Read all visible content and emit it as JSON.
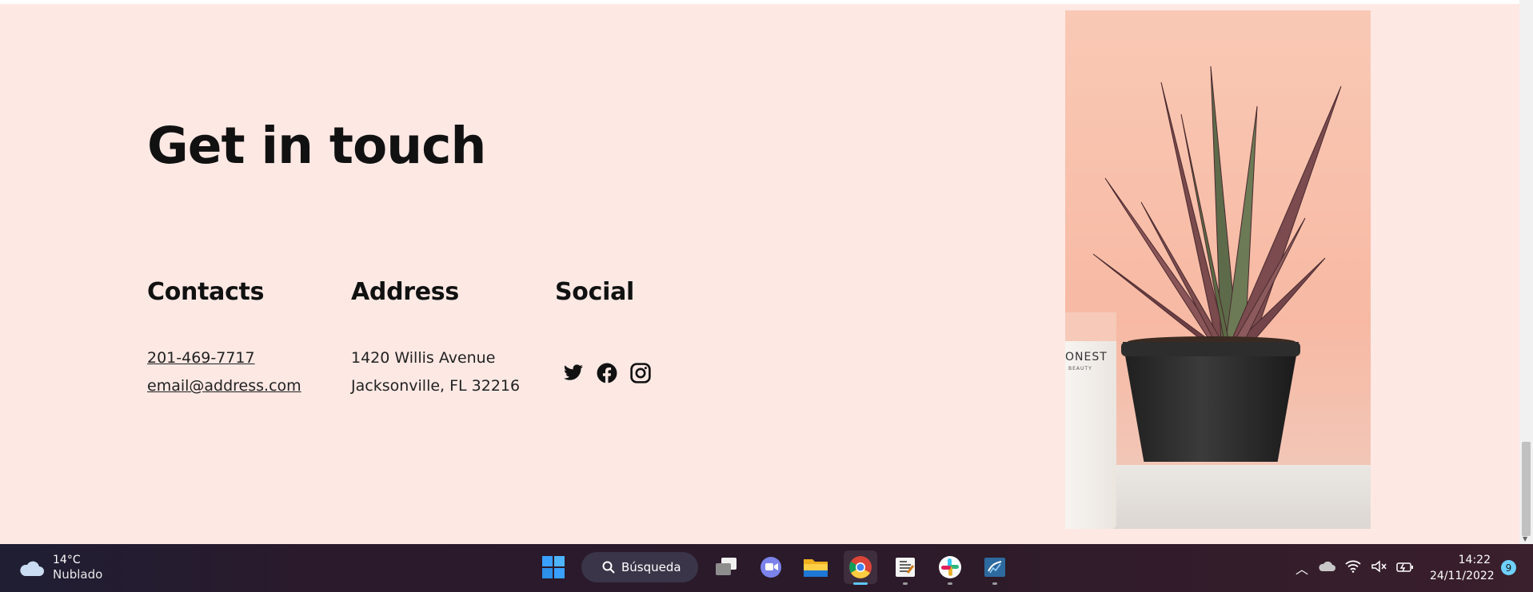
{
  "page": {
    "title": "Get in touch",
    "contacts": {
      "heading": "Contacts",
      "phone": "201-469-7717",
      "email": "email@address.com"
    },
    "address": {
      "heading": "Address",
      "line1": "1420 Willis Avenue",
      "line2": "Jacksonville, FL 32216"
    },
    "social": {
      "heading": "Social",
      "icons": [
        "twitter-icon",
        "facebook-icon",
        "instagram-icon"
      ]
    },
    "image": {
      "brand": "ONEST",
      "brand_sub": "BEAUTY"
    }
  },
  "taskbar": {
    "weather": {
      "temp": "14°C",
      "condition": "Nublado"
    },
    "search_label": "Búsqueda",
    "apps": [
      "windows-start",
      "task-view",
      "teams-chat",
      "file-explorer",
      "chrome",
      "editor",
      "slack",
      "mysql-workbench"
    ],
    "clock": {
      "time": "14:22",
      "date": "24/11/2022"
    },
    "notifications": "9"
  },
  "colors": {
    "page_bg": "#fde8e4",
    "text": "#111111",
    "taskbar": "#2a1a2c",
    "accent": "#5cc8ff"
  }
}
